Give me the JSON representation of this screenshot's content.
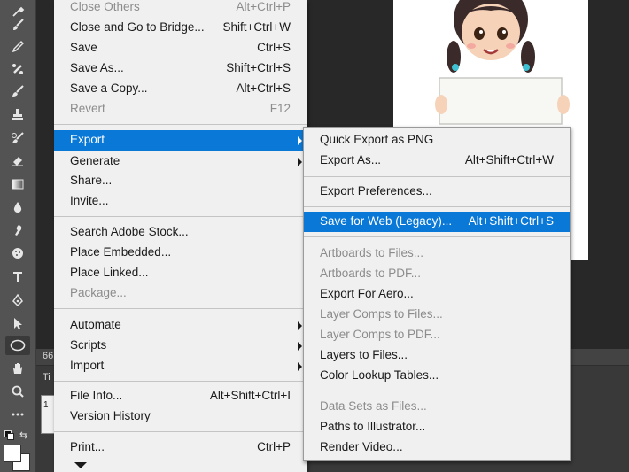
{
  "file_menu": {
    "items": [
      {
        "label": "Close Others",
        "shortcut": "Alt+Ctrl+P",
        "disabled": true
      },
      {
        "label": "Close and Go to Bridge...",
        "shortcut": "Shift+Ctrl+W"
      },
      {
        "label": "Save",
        "shortcut": "Ctrl+S"
      },
      {
        "label": "Save As...",
        "shortcut": "Shift+Ctrl+S"
      },
      {
        "label": "Save a Copy...",
        "shortcut": "Alt+Ctrl+S"
      },
      {
        "label": "Revert",
        "shortcut": "F12",
        "disabled": true
      },
      {
        "label": "Export",
        "shortcut": "",
        "submenu": true,
        "highlighted": true
      },
      {
        "label": "Generate",
        "shortcut": "",
        "submenu": true
      },
      {
        "label": "Share...",
        "shortcut": ""
      },
      {
        "label": "Invite...",
        "shortcut": ""
      },
      {
        "label": "Search Adobe Stock...",
        "shortcut": ""
      },
      {
        "label": "Place Embedded...",
        "shortcut": ""
      },
      {
        "label": "Place Linked...",
        "shortcut": ""
      },
      {
        "label": "Package...",
        "shortcut": "",
        "disabled": true
      },
      {
        "label": "Automate",
        "shortcut": "",
        "submenu": true
      },
      {
        "label": "Scripts",
        "shortcut": "",
        "submenu": true
      },
      {
        "label": "Import",
        "shortcut": "",
        "submenu": true
      },
      {
        "label": "File Info...",
        "shortcut": "Alt+Shift+Ctrl+I"
      },
      {
        "label": "Version History",
        "shortcut": ""
      },
      {
        "label": "Print...",
        "shortcut": "Ctrl+P"
      }
    ]
  },
  "export_menu": {
    "items": [
      {
        "label": "Quick Export as PNG",
        "shortcut": ""
      },
      {
        "label": "Export As...",
        "shortcut": "Alt+Shift+Ctrl+W"
      },
      {
        "label": "Export Preferences...",
        "shortcut": ""
      },
      {
        "label": "Save for Web (Legacy)...",
        "shortcut": "Alt+Shift+Ctrl+S",
        "highlighted": true
      },
      {
        "label": "Artboards to Files...",
        "shortcut": "",
        "disabled": true
      },
      {
        "label": "Artboards to PDF...",
        "shortcut": "",
        "disabled": true
      },
      {
        "label": "Export For Aero...",
        "shortcut": ""
      },
      {
        "label": "Layer Comps to Files...",
        "shortcut": "",
        "disabled": true
      },
      {
        "label": "Layer Comps to PDF...",
        "shortcut": "",
        "disabled": true
      },
      {
        "label": "Layers to Files...",
        "shortcut": ""
      },
      {
        "label": "Color Lookup Tables...",
        "shortcut": ""
      },
      {
        "label": "Data Sets as Files...",
        "shortcut": "",
        "disabled": true
      },
      {
        "label": "Paths to Illustrator...",
        "shortcut": ""
      },
      {
        "label": "Render Video...",
        "shortcut": ""
      }
    ]
  },
  "panel": {
    "zoom_fragment": "66",
    "tab_fragment": "Ti",
    "layer_fragment": "1"
  },
  "toolbar": {
    "tools": [
      "eyedropper-icon",
      "brush-icon",
      "pencil-icon",
      "healing-brush-icon",
      "brush-2-icon",
      "stamp-icon",
      "history-brush-icon",
      "eraser-icon",
      "gradient-icon",
      "blur-icon",
      "smudge-icon",
      "sponge-icon",
      "type-icon",
      "pen-icon",
      "path-select-icon",
      "ellipse-icon",
      "hand-icon",
      "zoom-icon",
      "more-tools-icon"
    ],
    "selected_tool": "ellipse-icon"
  },
  "colors": {
    "highlight": "#0a78d7",
    "menu_bg": "#f0f0f0",
    "disabled_text": "#8c8c8c",
    "toolbar_bg": "#535353",
    "workspace_bg": "#282828"
  }
}
